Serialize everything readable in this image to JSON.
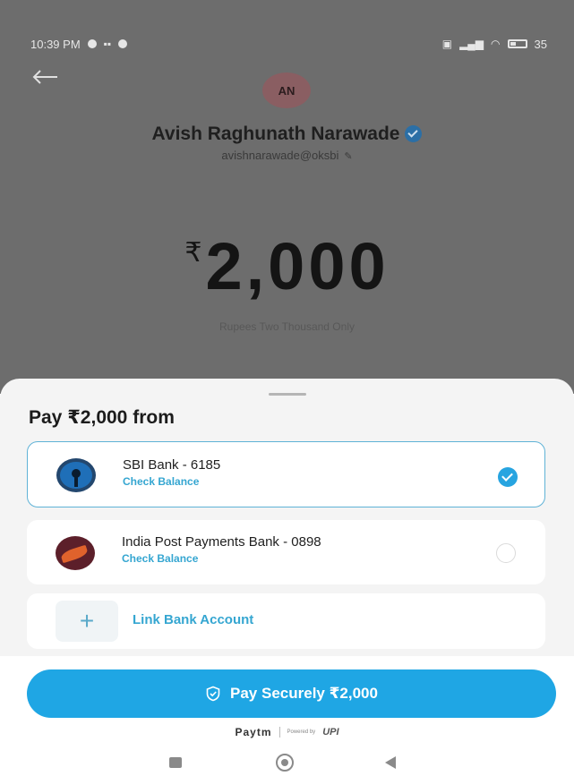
{
  "status_bar": {
    "time": "10:39 PM",
    "battery": "35"
  },
  "payee": {
    "initials": "AN",
    "name": "Avish Raghunath Narawade",
    "upi_id": "avishnarawade@oksbi"
  },
  "amount": {
    "currency_symbol": "₹",
    "value": "2,000",
    "in_words": "Rupees Two Thousand Only"
  },
  "sheet": {
    "title": "Pay ₹2,000 from",
    "accounts": [
      {
        "name": "SBI Bank - 6185",
        "action": "Check Balance",
        "selected": true,
        "logo": "sbi-logo"
      },
      {
        "name": "India Post Payments Bank - 0898",
        "action": "Check Balance",
        "selected": false,
        "logo": "ippb-logo"
      }
    ],
    "link_account_label": "Link Bank Account",
    "link_icon": "+"
  },
  "pay_button": {
    "label": "Pay Securely ₹2,000",
    "icon": "shield-check-icon"
  },
  "footer": {
    "brand": "Paytm",
    "powered_by": "Powered by",
    "upi": "UPI"
  },
  "colors": {
    "accent": "#1fa6e4",
    "link_text": "#35a6d1",
    "dim_overlay": "#6d6d6d",
    "selected_border": "#5fb2d6"
  }
}
